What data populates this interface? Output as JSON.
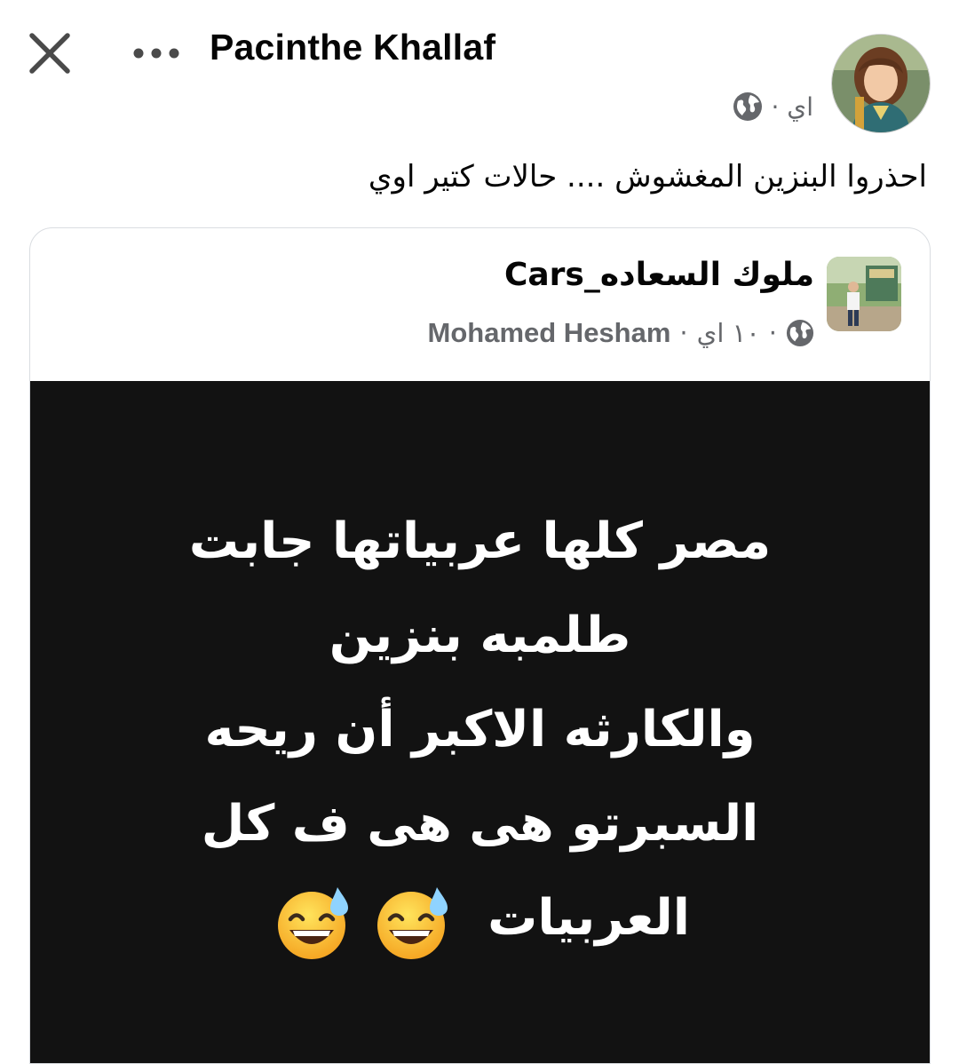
{
  "header": {
    "author_name": "Pacinthe Khallaf",
    "post_time": "اي ·",
    "audience_icon": "globe-icon"
  },
  "post": {
    "caption": "احذروا البنزين المغشوش .... حالات كتير اوي"
  },
  "shared_post": {
    "page_name": "ملوك السعاده_Cars",
    "post_time": "۱۰ اي",
    "poster_name": "Mohamed Hesham",
    "audience_icon": "globe-icon",
    "image_lines": [
      "مصر كلها عربياتها جابت",
      "طلمبه بنزين",
      "والكارثه الاكبر أن ريحه",
      "السبرتو هى هى ف كل",
      "العربيات"
    ],
    "emoji": "grinning-face-with-sweat-icon"
  },
  "colors": {
    "text_primary": "#050505",
    "text_secondary": "#65676b",
    "image_background": "#121212",
    "card_border": "#dadde1"
  }
}
